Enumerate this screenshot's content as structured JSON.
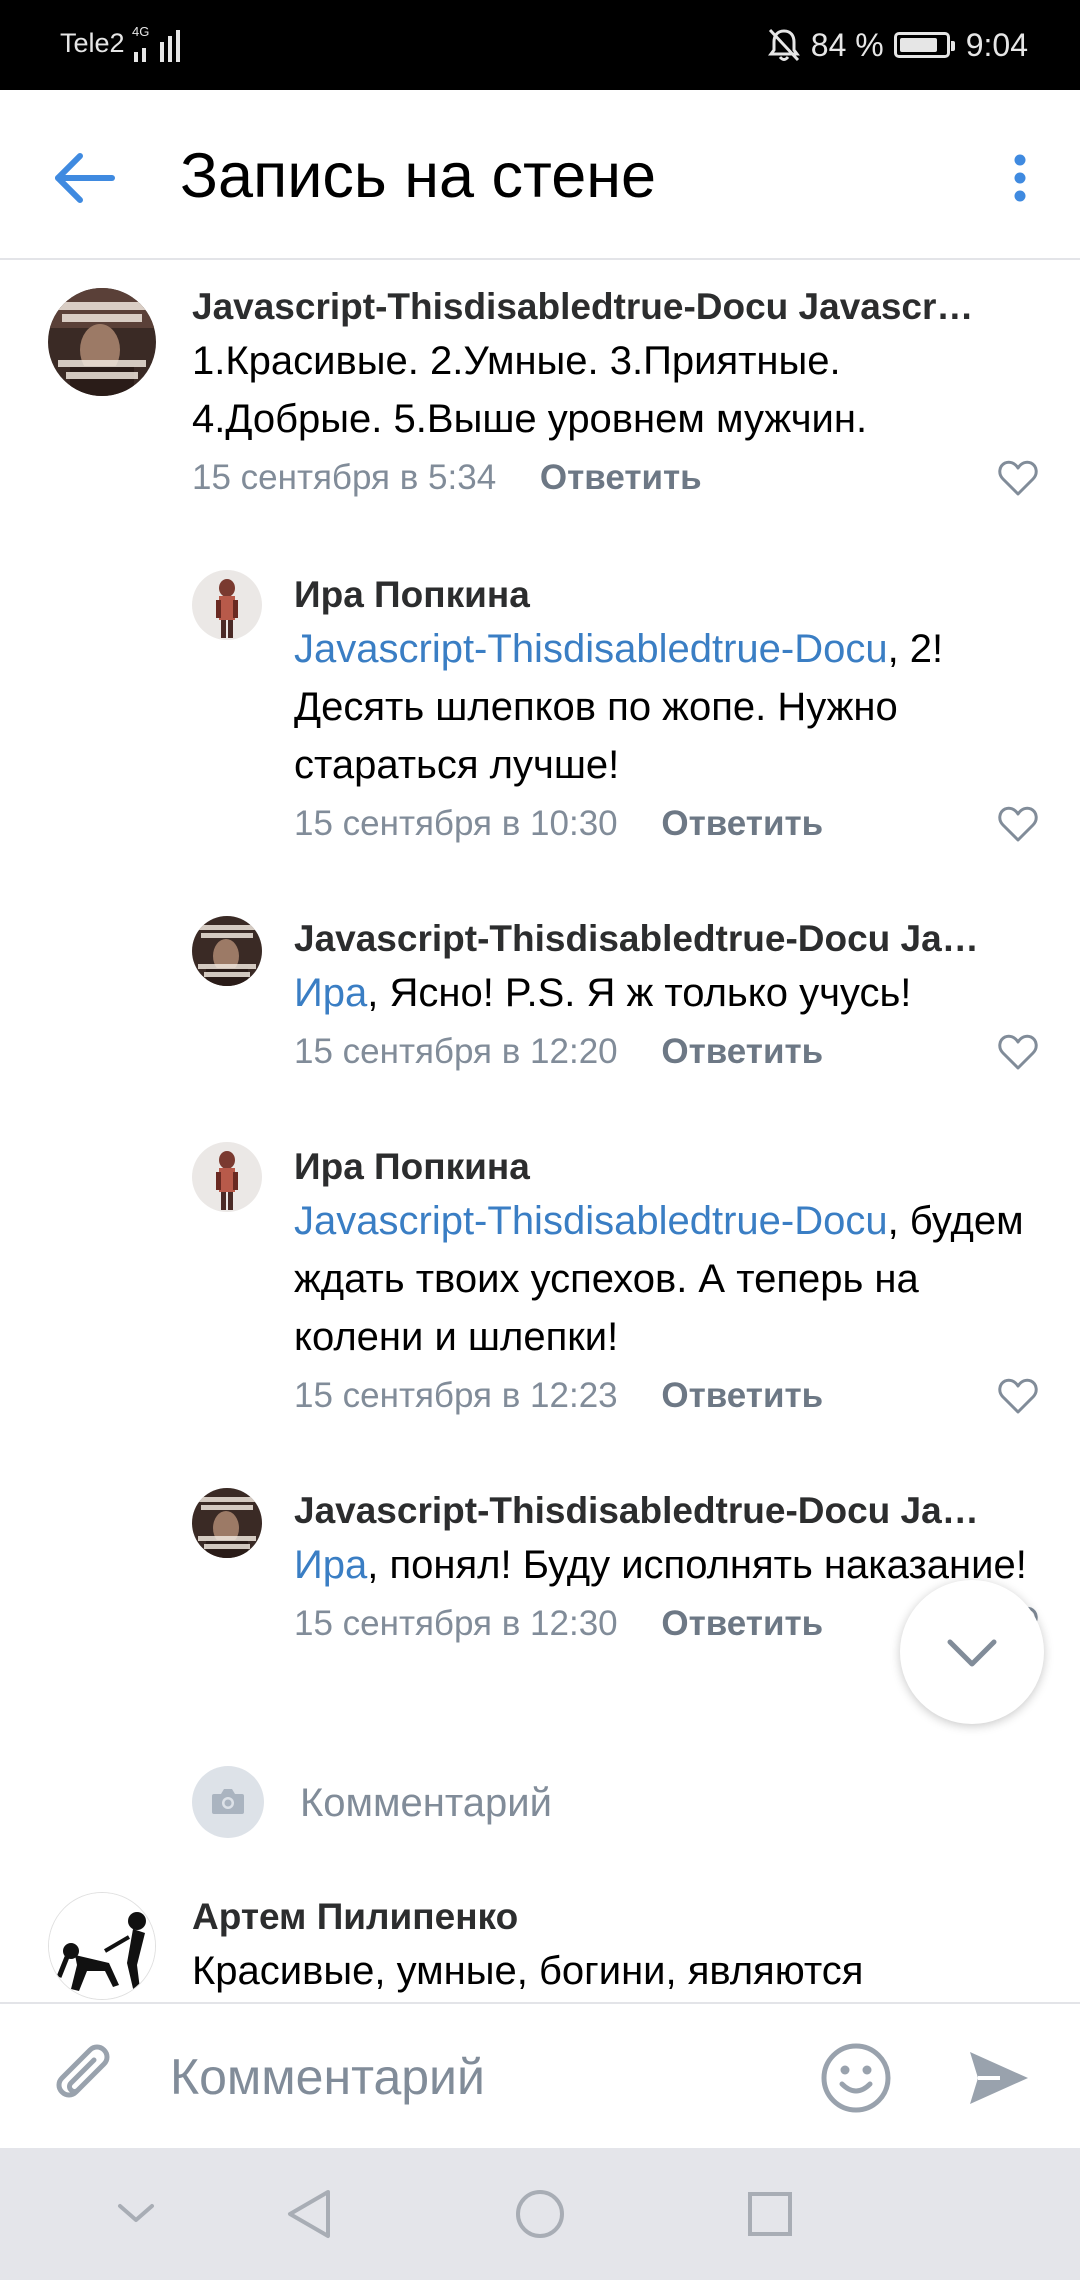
{
  "status_bar": {
    "carrier": "Tele2",
    "network": "4G",
    "battery_text": "84 %",
    "battery_level": 0.84,
    "time": "9:04",
    "icons": [
      "signal-icon",
      "mute-bell-icon",
      "battery-icon"
    ]
  },
  "header": {
    "title": "Запись на стене",
    "back_icon": "back-arrow-icon",
    "menu_icon": "more-vertical-icon"
  },
  "comments": [
    {
      "author": "Javascript-Thisdisabledtrue-Docu Javascr…",
      "mention": "",
      "text": "1.Красивые. 2.Умные. 3.Приятные. 4.Добрые. 5.Выше уровнем мужчин.",
      "time": "15 сентября в 5:34",
      "reply": "Ответить"
    },
    {
      "author": "Ира Попкина",
      "mention": "Javascript-Thisdisabledtrue-Docu",
      "text": ", 2! Десять шлепков по жопе. Нужно стараться лучше!",
      "time": "15 сентября в 10:30",
      "reply": "Ответить"
    },
    {
      "author": "Javascript-Thisdisabledtrue-Docu Ja…",
      "mention": "Ира",
      "text": ", Ясно! P.S. Я ж только учусь!",
      "time": "15 сентября в 12:20",
      "reply": "Ответить"
    },
    {
      "author": "Ира Попкина",
      "mention": "Javascript-Thisdisabledtrue-Docu",
      "text": ", будем ждать твоих успехов. А теперь на колени и шлепки!",
      "time": "15 сентября в 12:23",
      "reply": "Ответить"
    },
    {
      "author": "Javascript-Thisdisabledtrue-Docu Ja…",
      "mention": "Ира",
      "text": ", понял! Буду исполнять наказание!",
      "time": "15 сентября в 12:30",
      "reply": "Ответить"
    },
    {
      "author": "Артем Пилипенко",
      "mention": "",
      "text": "Красивые, умные, богини, являются",
      "time": "",
      "reply": ""
    }
  ],
  "comment_prompt": {
    "label": "Комментарий",
    "icon": "camera-icon"
  },
  "composer": {
    "placeholder": "Комментарий",
    "attach_icon": "paperclip-icon",
    "emoji_icon": "smile-icon",
    "send_icon": "send-icon"
  },
  "nav_bar": {
    "icons": [
      "hide-keyboard-icon",
      "back-triangle-icon",
      "home-circle-icon",
      "recents-square-icon"
    ]
  },
  "colors": {
    "accent": "#3f8ae0",
    "mention": "#3a7ec4",
    "secondary_text": "#818c99",
    "status_bar": "#000000",
    "nav_bar": "#e4e5ea"
  }
}
